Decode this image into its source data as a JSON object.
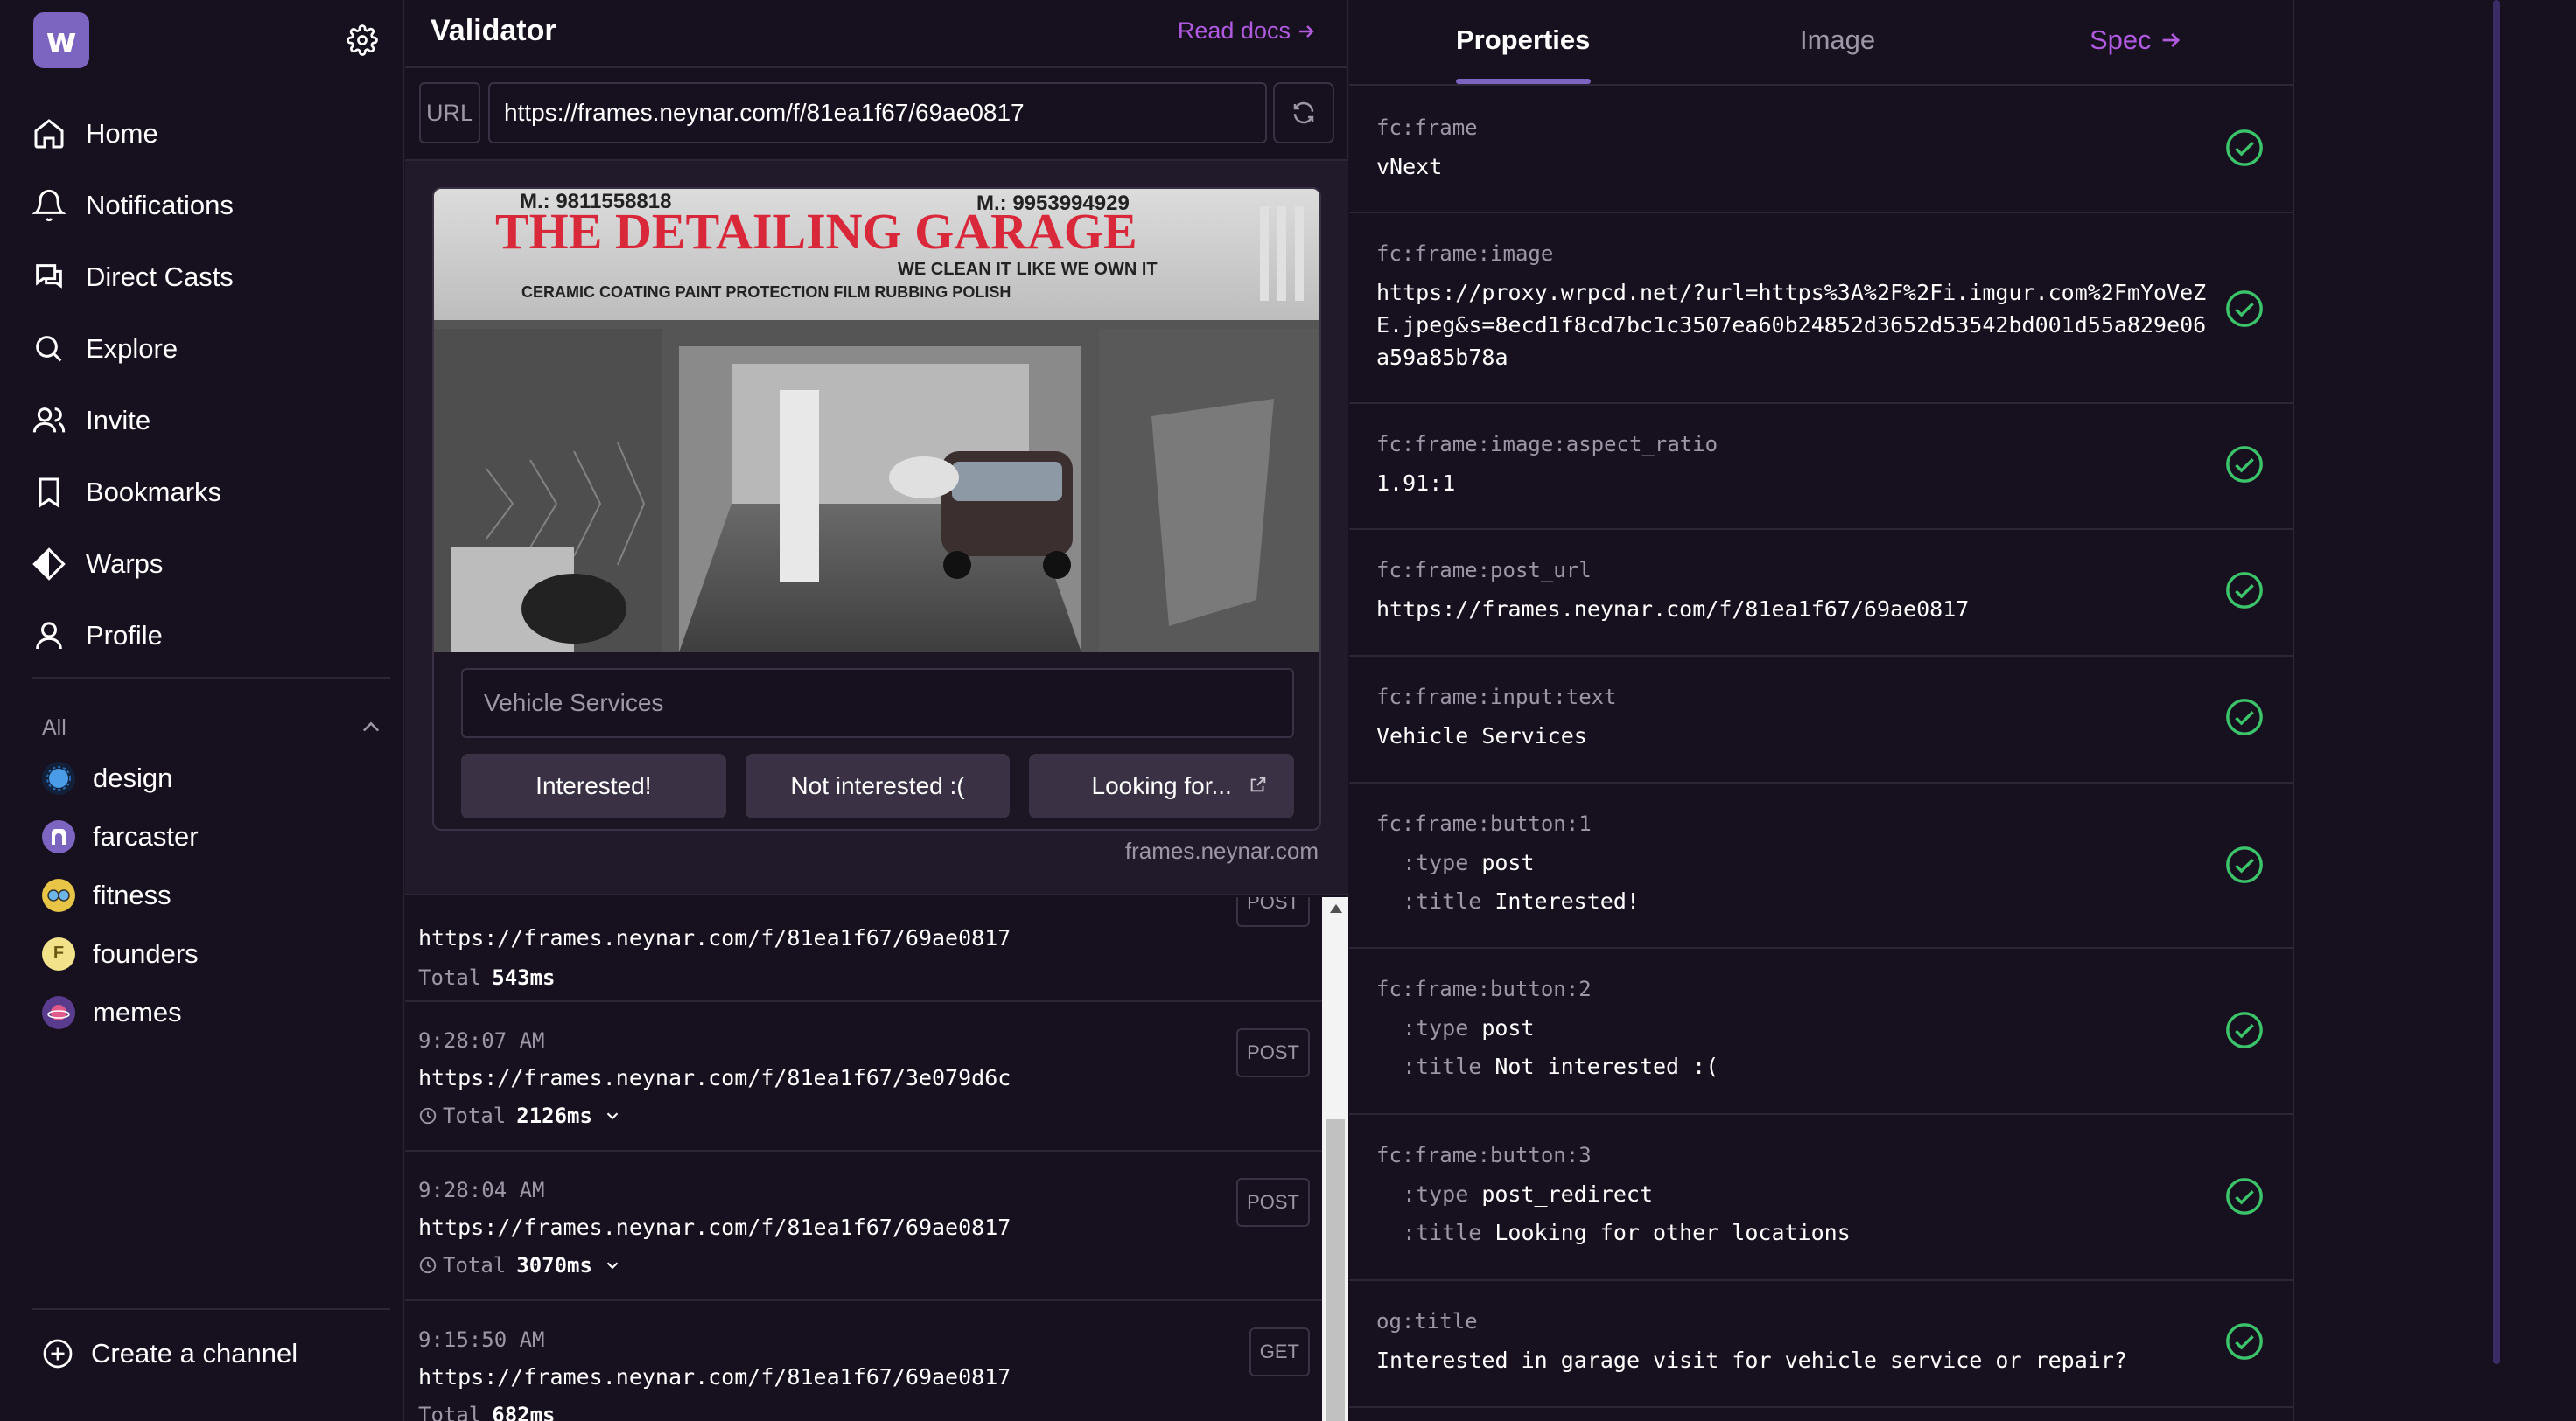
{
  "sidebar": {
    "logo_letter": "w",
    "nav": [
      {
        "label": "Home",
        "icon": "home-icon"
      },
      {
        "label": "Notifications",
        "icon": "bell-icon"
      },
      {
        "label": "Direct Casts",
        "icon": "chat-icon"
      },
      {
        "label": "Explore",
        "icon": "search-icon"
      },
      {
        "label": "Invite",
        "icon": "users-icon"
      },
      {
        "label": "Bookmarks",
        "icon": "bookmark-icon"
      },
      {
        "label": "Warps",
        "icon": "diamond-icon"
      },
      {
        "label": "Profile",
        "icon": "user-icon"
      }
    ],
    "channels_header": "All",
    "channels": [
      {
        "label": "design",
        "color": "#2b6cb0"
      },
      {
        "label": "farcaster",
        "color": "#7c65c1"
      },
      {
        "label": "fitness",
        "color": "#e8c547"
      },
      {
        "label": "founders",
        "color": "#f2e38b",
        "letter": "F"
      },
      {
        "label": "memes",
        "color": "#5a3c8e"
      }
    ],
    "create_channel": "Create a channel"
  },
  "validator": {
    "title": "Validator",
    "read_docs": "Read docs",
    "url_label": "URL",
    "url_value": "https://frames.neynar.com/f/81ea1f67/69ae0817",
    "frame": {
      "sign_top_left": "M.: 9811558818",
      "sign_top_right": "M.: 9953994929",
      "sign_title": "THE DETAILING GARAGE",
      "sign_tagline": "WE CLEAN IT LIKE WE OWN IT",
      "sign_services": "CERAMIC COATING   PAINT PROTECTION FILM   RUBBING POLISH",
      "input_placeholder": "Vehicle Services",
      "buttons": [
        "Interested!",
        "Not interested :(",
        "Looking for..."
      ],
      "domain": "frames.neynar.com"
    },
    "log": [
      {
        "time": "",
        "method": "POST",
        "url": "https://frames.neynar.com/f/81ea1f67/69ae0817",
        "total_label": "Total",
        "total": "543ms"
      },
      {
        "time": "9:28:07 AM",
        "method": "POST",
        "url": "https://frames.neynar.com/f/81ea1f67/3e079d6c",
        "total_label": "Total",
        "total": "2126ms"
      },
      {
        "time": "9:28:04 AM",
        "method": "POST",
        "url": "https://frames.neynar.com/f/81ea1f67/69ae0817",
        "total_label": "Total",
        "total": "3070ms"
      },
      {
        "time": "9:15:50 AM",
        "method": "GET",
        "url": "https://frames.neynar.com/f/81ea1f67/69ae0817",
        "total_label": "Total",
        "total": "682ms"
      }
    ]
  },
  "properties": {
    "tabs": {
      "properties": "Properties",
      "image": "Image",
      "spec": "Spec"
    },
    "items": [
      {
        "key": "fc:frame",
        "value": "vNext"
      },
      {
        "key": "fc:frame:image",
        "value": "https://proxy.wrpcd.net/?url=https%3A%2F%2Fi.imgur.com%2FmYoVeZE.jpeg&s=8ecd1f8cd7bc1c3507ea60b24852d3652d53542bd001d55a829e06a59a85b78a"
      },
      {
        "key": "fc:frame:image:aspect_ratio",
        "value": "1.91:1"
      },
      {
        "key": "fc:frame:post_url",
        "value": "https://frames.neynar.com/f/81ea1f67/69ae0817"
      },
      {
        "key": "fc:frame:input:text",
        "value": "Vehicle Services"
      },
      {
        "key": "fc:frame:button:1",
        "type_label": ":type",
        "type": "post",
        "title_label": ":title",
        "title": "Interested!"
      },
      {
        "key": "fc:frame:button:2",
        "type_label": ":type",
        "type": "post",
        "title_label": ":title",
        "title": "Not interested :("
      },
      {
        "key": "fc:frame:button:3",
        "type_label": ":type",
        "type": "post_redirect",
        "title_label": ":title",
        "title": "Looking for other locations"
      },
      {
        "key": "og:title",
        "value": "Interested in garage visit for vehicle service or repair?"
      }
    ]
  },
  "colors": {
    "accent": "#7c65c1",
    "link": "#b05ae0",
    "valid": "#3cc46b",
    "background": "#17101f"
  }
}
